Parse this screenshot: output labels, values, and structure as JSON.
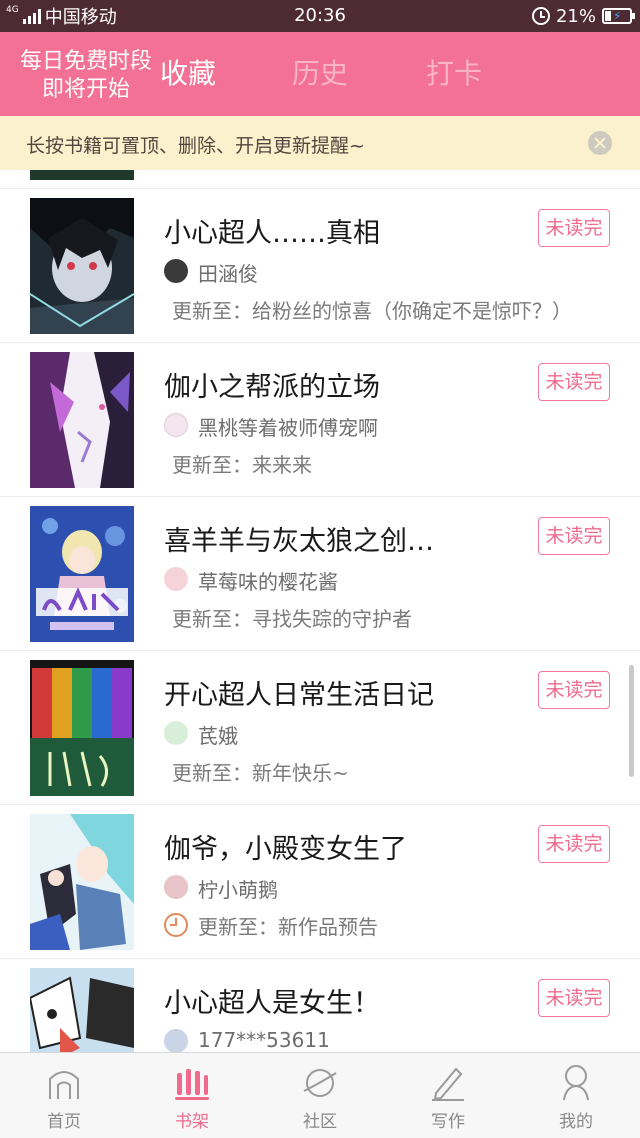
{
  "status_bar": {
    "network": "4G",
    "carrier": "中国移动",
    "time": "20:36",
    "battery": "21%"
  },
  "header": {
    "promo_line1": "每日免费时段",
    "promo_line2": "即将开始",
    "tabs": [
      {
        "label": "收藏",
        "active": true
      },
      {
        "label": "历史",
        "active": false
      },
      {
        "label": "打卡",
        "active": false
      }
    ]
  },
  "notice": {
    "text": "长按书籍可置顶、删除、开启更新提醒~"
  },
  "books": [
    {
      "title": "小心超人……真相",
      "author": "田涵俊",
      "update": "更新至：给粉丝的惊喜（你确定不是惊吓？）",
      "badge": "未读完"
    },
    {
      "title": "伽小之帮派的立场",
      "author": "黑桃等着被师傅宠啊",
      "update": "更新至：来来来",
      "badge": "未读完"
    },
    {
      "title": "喜羊羊与灰太狼之创…",
      "author": "草莓味的樱花酱",
      "update": "更新至：寻找失踪的守护者",
      "badge": "未读完"
    },
    {
      "title": "开心超人日常生活日记",
      "author": "芪娥",
      "update": "更新至：新年快乐~",
      "badge": "未读完"
    },
    {
      "title": "伽爷，小殿变女生了",
      "author": "柠小萌鹅",
      "update": "更新至：新作品预告",
      "badge": "未读完"
    },
    {
      "title": "小心超人是女生！",
      "author": "177***53611",
      "update": "",
      "badge": "未读完"
    }
  ],
  "bottom_nav": [
    {
      "label": "首页",
      "icon": "home-icon",
      "active": false
    },
    {
      "label": "书架",
      "icon": "bookshelf-icon",
      "active": true
    },
    {
      "label": "社区",
      "icon": "planet-icon",
      "active": false
    },
    {
      "label": "写作",
      "icon": "pen-icon",
      "active": false
    },
    {
      "label": "我的",
      "icon": "profile-icon",
      "active": false
    }
  ],
  "colors": {
    "accent": "#f27194",
    "badge": "#f06a8e",
    "notice_bg": "#fbf1cd",
    "status_bar": "#4e2a33"
  }
}
